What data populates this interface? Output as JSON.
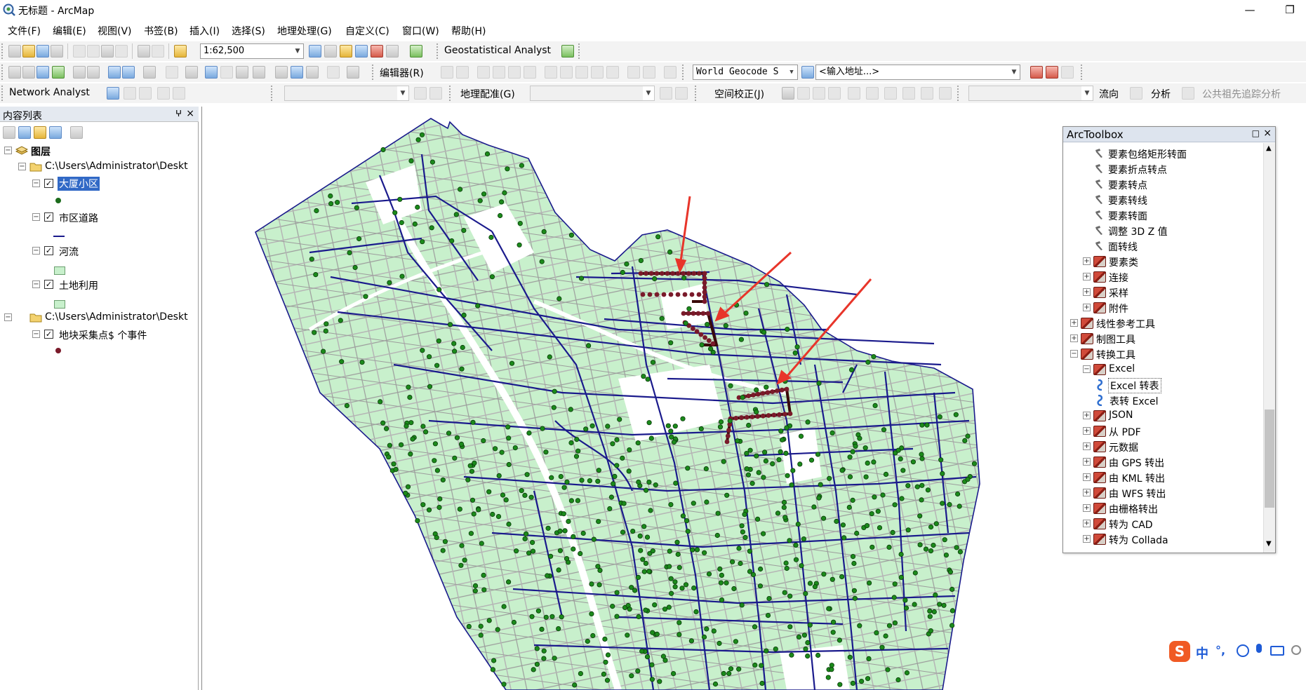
{
  "window": {
    "title": "无标题 - ArcMap",
    "minimize": "—",
    "restore": "❐"
  },
  "menu": [
    "文件(F)",
    "编辑(E)",
    "视图(V)",
    "书签(B)",
    "插入(I)",
    "选择(S)",
    "地理处理(G)",
    "自定义(C)",
    "窗口(W)",
    "帮助(H)"
  ],
  "toolbar1": {
    "scale": "1:62,500",
    "geostat": "Geostatistical Analyst"
  },
  "toolbar2": {
    "editor": "编辑器(R)",
    "geocode": "World Geocode S",
    "address_placeholder": "<输入地址...>"
  },
  "toolbar3": {
    "network": "Network Analyst",
    "georef": "地理配准(G)",
    "spatial_adjust": "空间校正(J)",
    "flow": "流向",
    "analysis": "分析",
    "utility": "公共祖先追踪分析"
  },
  "toc": {
    "title": "内容列表",
    "pin": "ⵖ",
    "close": "×",
    "root": "图层",
    "groups": [
      {
        "path": "C:\\Users\\Administrator\\Deskt",
        "layers": [
          "大厦小区",
          "市区道路",
          "河流",
          "土地利用"
        ]
      },
      {
        "path": "C:\\Users\\Administrator\\Deskt",
        "layers": [
          "地块采集点$ 个事件"
        ]
      }
    ]
  },
  "toolbox": {
    "title": "ArcToolbox",
    "tools_top": [
      "要素包络矩形转面",
      "要素折点转点",
      "要素转点",
      "要素转线",
      "要素转面",
      "调整 3D Z 值",
      "面转线"
    ],
    "sets_a": [
      "要素类",
      "连接",
      "采样",
      "附件"
    ],
    "boxes": [
      "线性参考工具",
      "制图工具",
      "转换工具"
    ],
    "excel_set": "Excel",
    "excel_tools": [
      "Excel 转表",
      "表转 Excel"
    ],
    "sets_b": [
      "JSON",
      "从 PDF",
      "元数据",
      "由 GPS 转出",
      "由 KML 转出",
      "由 WFS 转出",
      "由栅格转出",
      "转为 CAD",
      "转为 Collada"
    ]
  },
  "ime": {
    "logo": "S",
    "lang": "中",
    "punct": "°,"
  },
  "colors": {
    "landuse": "#c8f0cc",
    "road": "#1a1a8c",
    "point": "#1b8a1b",
    "building": "#7a1a1a",
    "arrow": "#e8352a"
  }
}
